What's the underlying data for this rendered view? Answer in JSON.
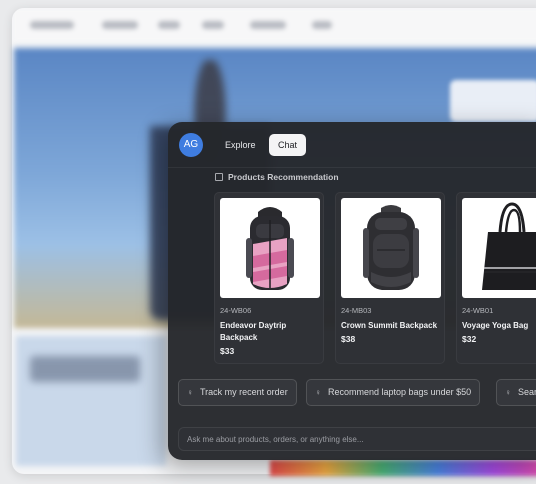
{
  "header": {
    "avatar_initials": "AG",
    "tabs": [
      {
        "label": "Explore",
        "active": false
      },
      {
        "label": "Chat",
        "active": true
      }
    ]
  },
  "section": {
    "title": "Products Recommendation"
  },
  "products": [
    {
      "sku": "24-WB06",
      "name": "Endeavor Daytrip Backpack",
      "price": "$33",
      "image": "pink-backpack"
    },
    {
      "sku": "24-MB03",
      "name": "Crown Summit Backpack",
      "price": "$38",
      "image": "black-backpack"
    },
    {
      "sku": "24-WB01",
      "name": "Voyage Yoga Bag",
      "price": "$32",
      "image": "black-tote-bag"
    }
  ],
  "suggestions": [
    {
      "label": "Track my recent order",
      "icon": "lightbulb-icon"
    },
    {
      "label": "Recommend laptop bags under $50",
      "icon": "lightbulb-icon"
    },
    {
      "label": "Sear",
      "icon": "lightbulb-icon"
    }
  ],
  "input": {
    "placeholder": "Ask me about products, orders, or anything else..."
  },
  "colors": {
    "panel_bg": "#24262b",
    "avatar_bg": "#3f7de0",
    "active_tab_bg": "#f4f4f5",
    "card_bg": "#2f3136"
  }
}
